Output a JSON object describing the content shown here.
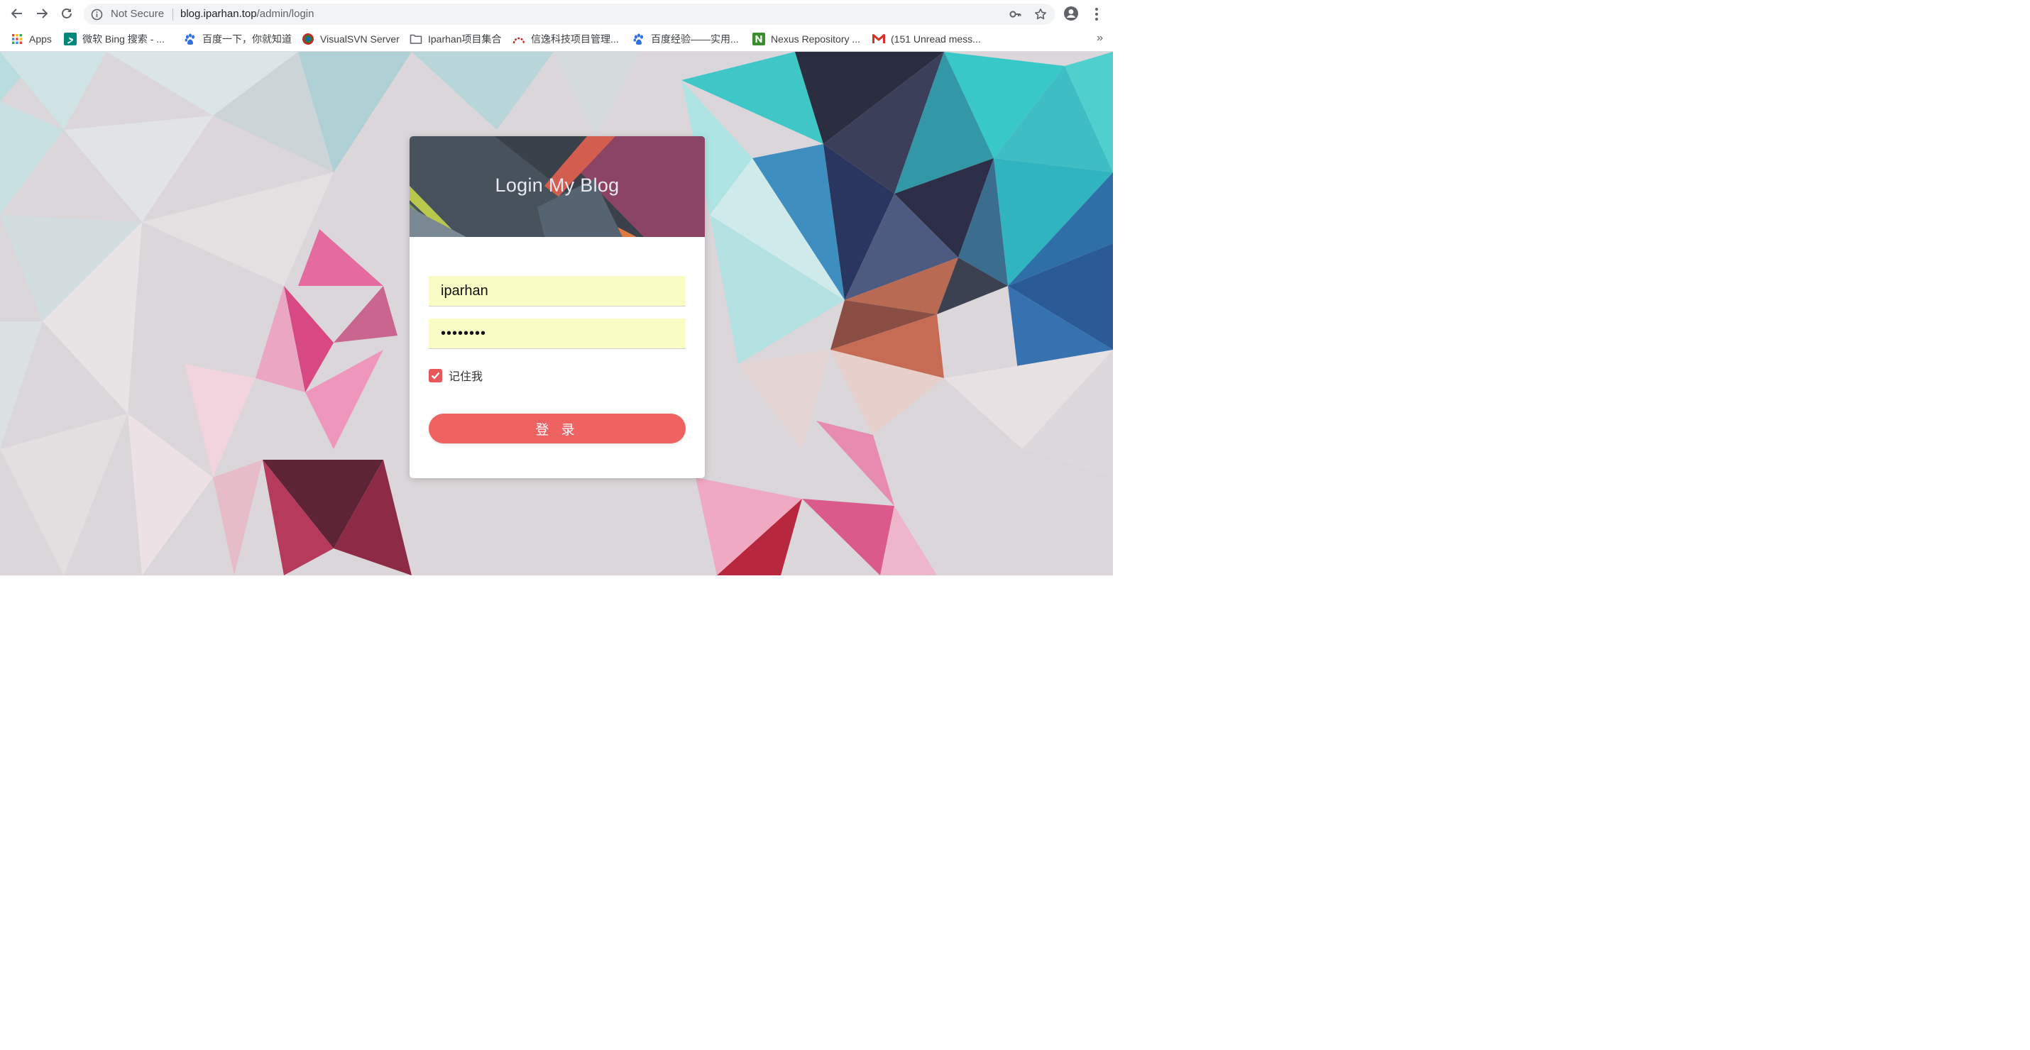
{
  "browser": {
    "security_label": "Not Secure",
    "url_host": "blog.iparhan.top",
    "url_path": "/admin/login"
  },
  "bookmarks": {
    "items": [
      {
        "label": "Apps",
        "icon": "apps-grid-icon"
      },
      {
        "label": "微软 Bing 搜索 - ...",
        "icon": "bing-icon"
      },
      {
        "label": "百度一下，你就知道",
        "icon": "baidu-paw-icon"
      },
      {
        "label": "VisualSVN Server",
        "icon": "visualsvn-icon"
      },
      {
        "label": "Iparhan项目集合",
        "icon": "folder-icon"
      },
      {
        "label": "信逸科技项目管理...",
        "icon": "red-arc-icon"
      },
      {
        "label": "百度经验——实用...",
        "icon": "baidu-paw-icon"
      },
      {
        "label": "Nexus Repository ...",
        "icon": "nexus-icon"
      },
      {
        "label": "(151 Unread mess...",
        "icon": "gmail-icon"
      }
    ],
    "overflow": "»"
  },
  "login": {
    "title": "Login My Blog",
    "username_value": "iparhan",
    "password_value": "••••••••",
    "remember_label": "记住我",
    "remember_checked": true,
    "submit_label": "登 录"
  },
  "colors": {
    "accent": "#ee6261",
    "input_bg": "#f9fdc5",
    "checkbox": "#e9575b"
  }
}
